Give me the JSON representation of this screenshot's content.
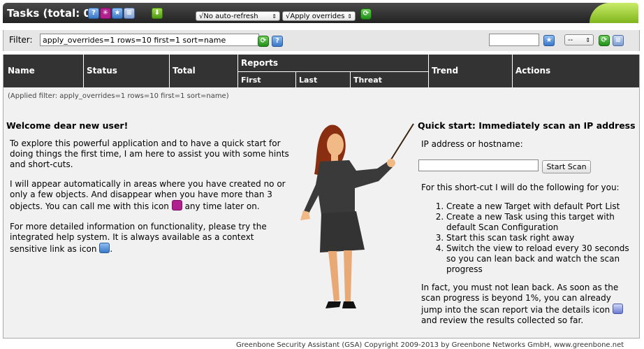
{
  "header": {
    "title": "Tasks (total: 0)",
    "refresh_select": "√No auto-refresh",
    "overrides_select": "√Apply overrides"
  },
  "filter": {
    "label": "Filter:",
    "value": "apply_overrides=1 rows=10 first=1 sort=name",
    "select_value": "--",
    "applied": "(Applied filter: apply_overrides=1 rows=10 first=1 sort=name)"
  },
  "table": {
    "columns": [
      "Name",
      "Status",
      "Total",
      "Reports",
      "Trend",
      "Actions"
    ],
    "report_subcolumns": [
      "First",
      "Last",
      "Threat"
    ]
  },
  "welcome": {
    "heading": "Welcome dear new user!",
    "p1": "To explore this powerful application and to have a quick start for doing things the first time, I am here to assist you with some hints and short-cuts.",
    "p2a": "I will appear automatically in areas where you have created no or only a few objects. And disappear when you have more than 3 objects. You can call me with this icon",
    "p2b": "any time later on.",
    "p3a": "For more detailed information on functionality, please try the integrated help system. It is always available as a context sensitive link as icon",
    "p3b": "."
  },
  "quickstart": {
    "heading": "Quick start: Immediately scan an IP address",
    "ip_label": "IP address or hostname:",
    "button": "Start Scan",
    "intro": "For this short-cut I will do the following for you:",
    "steps": [
      "Create a new Target with default Port List",
      "Create a new Task using this target with default Scan Configuration",
      "Start this scan task right away",
      "Switch the view to reload every 30 seconds so you can lean back and watch the scan progress"
    ],
    "outro_a": "In fact, you must not lean back. As soon as the scan progress is beyond 1%, you can already jump into the scan report via the details icon",
    "outro_b": "and review the results collected so far."
  },
  "footer": "Greenbone Security Assistant (GSA) Copyright 2009-2013 by Greenbone Networks GmbH, www.greenbone.net",
  "icons": [
    "help-icon",
    "wizard-icon",
    "new-task-icon",
    "task-list-icon",
    "download-icon",
    "refresh-icon",
    "details-icon"
  ],
  "colors": {
    "header": "#333333",
    "accent_green": "#7fb51c",
    "panel": "#f1f1f1"
  }
}
